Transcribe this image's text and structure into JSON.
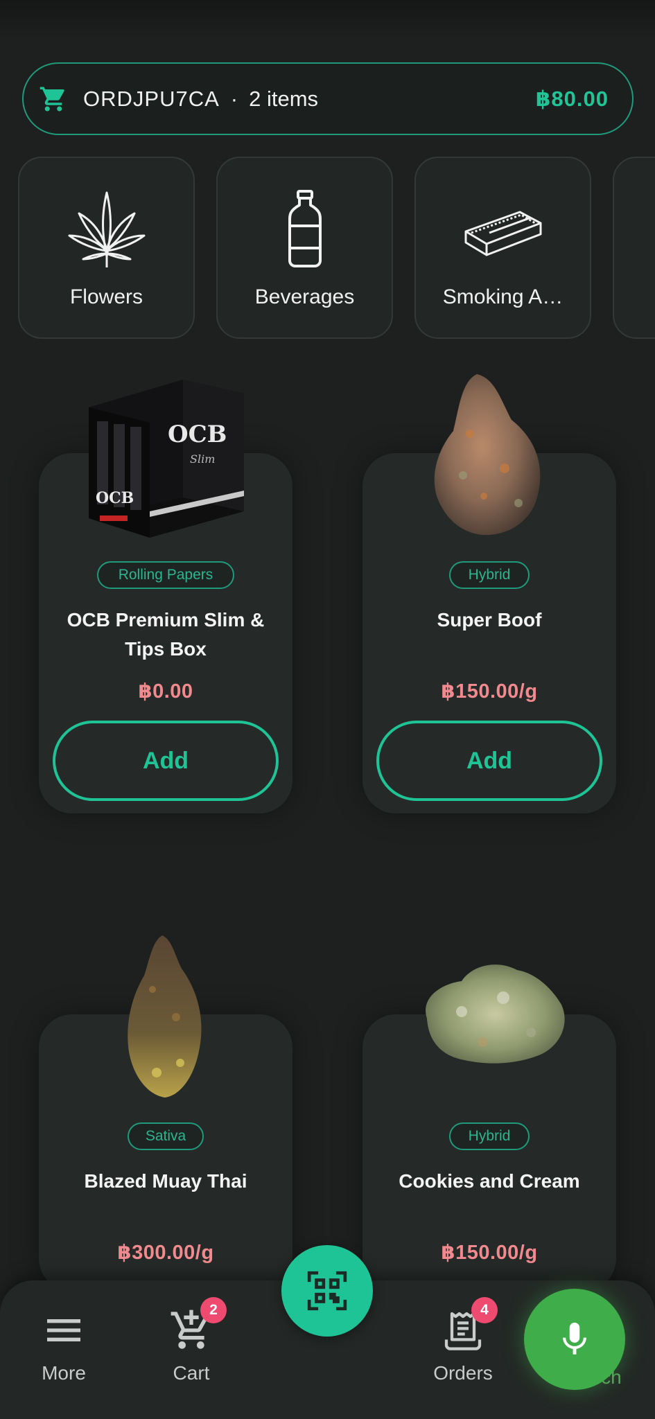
{
  "cart_bar": {
    "icon": "shopping-cart-icon",
    "order_id": "ORDJPU7CA",
    "separator": "·",
    "items": "2 items",
    "total": "฿80.00"
  },
  "categories": [
    {
      "label": "Flowers",
      "icon": "cannabis-leaf-icon"
    },
    {
      "label": "Beverages",
      "icon": "bottle-icon"
    },
    {
      "label": "Smoking A…",
      "icon": "rolling-papers-icon"
    }
  ],
  "products": [
    {
      "tag": "Rolling Papers",
      "name_line1": "OCB Premium Slim &",
      "name_line2": "Tips Box",
      "price": "฿0.00",
      "add_label": "Add",
      "image": "ocb-box-image"
    },
    {
      "tag": "Hybrid",
      "name_line1": "Super Boof",
      "name_line2": "",
      "price": "฿150.00/g",
      "add_label": "Add",
      "image": "cannabis-bud-image"
    },
    {
      "tag": "Sativa",
      "name_line1": "Blazed Muay Thai",
      "name_line2": "",
      "price": "฿300.00/g",
      "image": "cannabis-bud-image"
    },
    {
      "tag": "Hybrid",
      "name_line1": "Cookies and Cream",
      "name_line2": "",
      "price": "฿150.00/g",
      "image": "cannabis-bud-image"
    }
  ],
  "nav": {
    "more": "More",
    "cart": "Cart",
    "cart_badge": "2",
    "orders": "Orders",
    "orders_badge": "4",
    "search": "Search"
  },
  "colors": {
    "accent": "#1fc496",
    "price": "#f08a8f",
    "badge": "#ef4a6f",
    "mic": "#3fae4a",
    "background": "#1d201f"
  }
}
